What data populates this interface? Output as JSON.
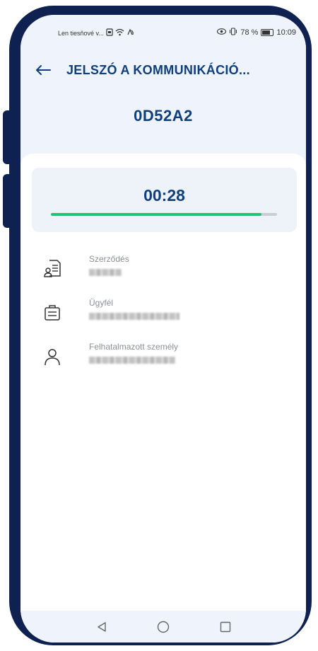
{
  "status_bar": {
    "carrier": "Len tiesňové v...",
    "battery_percent": "78 %",
    "time": "10:09"
  },
  "header": {
    "title": "JELSZÓ A KOMMUNIKÁCIÓ...",
    "code": "0D52A2"
  },
  "timer": {
    "value": "00:28",
    "progress_fraction": 0.93,
    "progress_color": "#25c16f"
  },
  "info_rows": [
    {
      "label": "Szerződés",
      "icon": "contract-icon"
    },
    {
      "label": "Ügyfél",
      "icon": "briefcase-icon"
    },
    {
      "label": "Felhatalmazott személy",
      "icon": "person-icon"
    }
  ],
  "colors": {
    "frame": "#0e2151",
    "title": "#0f3f7d",
    "header_bg": "#eef3fc"
  }
}
